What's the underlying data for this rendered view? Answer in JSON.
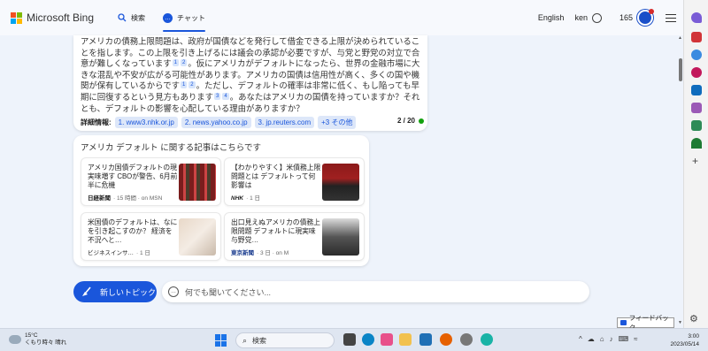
{
  "header": {
    "brand": "Microsoft Bing",
    "tabs": [
      {
        "label": "検索"
      },
      {
        "label": "チャット"
      }
    ],
    "language": "English",
    "user": "ken",
    "points": "165"
  },
  "answer": {
    "lines": [
      "アメリカの債務上限問題は、政府が国債などを発行して借金できる上限が決められていることを指します。この上限を引き上げるには議会の承認が必要ですが、与党と野党の対立で合意が難しくなっています",
      "。仮にアメリカがデフォルトになったら、世界の金融市場に大きな混乱や不安が広がる可能性があります。アメリカの国債は信用性が高く、多くの国や機関が保有しているからです",
      "。ただし、デフォルトの確率は非常に低く、もし陥っても早期に回復するという見方もあります",
      "。あなたはアメリカの国債を持っていますか？それとも、デフォルトの影響を心配している理由がありますか？"
    ],
    "citations": [
      "1",
      "2",
      "1",
      "2",
      "3",
      "4"
    ],
    "refs_label": "詳細情報:",
    "refs": [
      "1. www3.nhk.or.jp",
      "2. news.yahoo.co.jp",
      "3. jp.reuters.com",
      "+3 その他"
    ],
    "page_count": "2 / 20"
  },
  "news": {
    "title": "アメリカ デフォルト に関する記事はこちらです",
    "items": [
      {
        "headline": "アメリカ国債デフォルトの現実味増す CBOが警告、6月前半に危機",
        "source": "日経新聞",
        "time": "· 15 時間 · on MSN"
      },
      {
        "headline": "【わかりやすく】米債務上限問題とは デフォルトって何 影響は",
        "source": "NHK",
        "time": "· 1 日"
      },
      {
        "headline": "米国債のデフォルトは、なにを引き起こすのか？ 経済を不況へと…",
        "source": "ビジネスインサ…",
        "time": "· 1 日"
      },
      {
        "headline": "出口見えぬアメリカの債務上限問題 デフォルトに現実味 与野党…",
        "source": "東京新聞",
        "time": "· 3 日 · on M"
      }
    ]
  },
  "composer": {
    "new_topic": "新しいトピック",
    "placeholder": "何でも聞いてください..."
  },
  "feedback": "フィードバック",
  "taskbar": {
    "weather_temp": "15°C",
    "weather_desc": "くもり時々 晴れ",
    "search": "検索",
    "time": "3:00",
    "date": "2023/05/14"
  }
}
